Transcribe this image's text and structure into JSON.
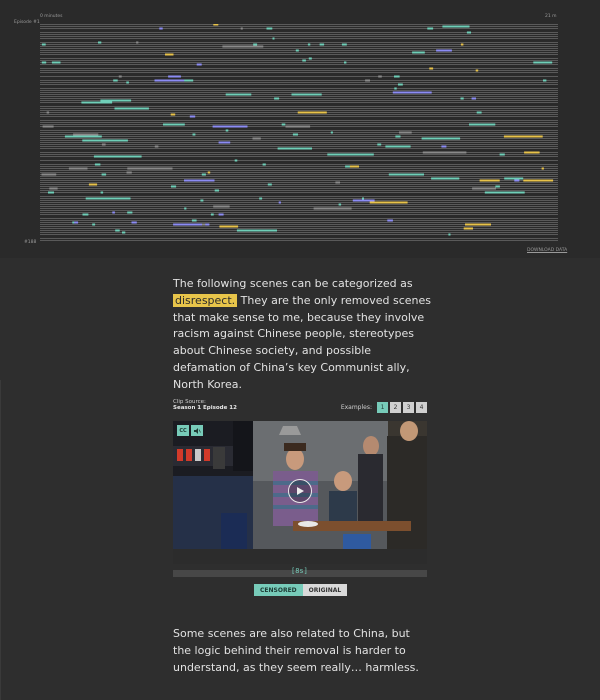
{
  "timeline": {
    "start_label": "0 minutes",
    "end_label": "21 m",
    "row_label_top": "Episode #1",
    "row_label_bottom": "#188",
    "download_label": "DOWNLOAD DATA",
    "colors": {
      "teal": "#6fcfb8",
      "blue": "#8c8cf5",
      "yellow": "#e8c34a",
      "grey": "#8a8a8a",
      "row": "#5a5a5a"
    }
  },
  "paragraph_1": {
    "before_highlight": "The following scenes can be categorized as",
    "highlight": "disrespect.",
    "after_highlight": " They are the only removed scenes that make sense to me, because they involve racism against Chinese people, stereotypes about Chinese society, and possible defamation of China’s key Communist ally, North Korea."
  },
  "clip": {
    "source_label": "Clip Source:",
    "source_value": "Season 1 Episode 12",
    "examples_label": "Examples:",
    "examples": [
      "1",
      "2",
      "3",
      "4"
    ],
    "active_example": "1",
    "cc_label": "CC",
    "audio_icon": "speaker-icon",
    "play_icon": "play-icon",
    "scrub_marker": "[8s]",
    "toggle_censored": "CENSORED",
    "toggle_original": "ORIGINAL",
    "active_toggle": "CENSORED"
  },
  "paragraph_2": {
    "text": "Some scenes are also related to China, but the logic behind their removal is harder to understand, as they seem really… harmless."
  }
}
